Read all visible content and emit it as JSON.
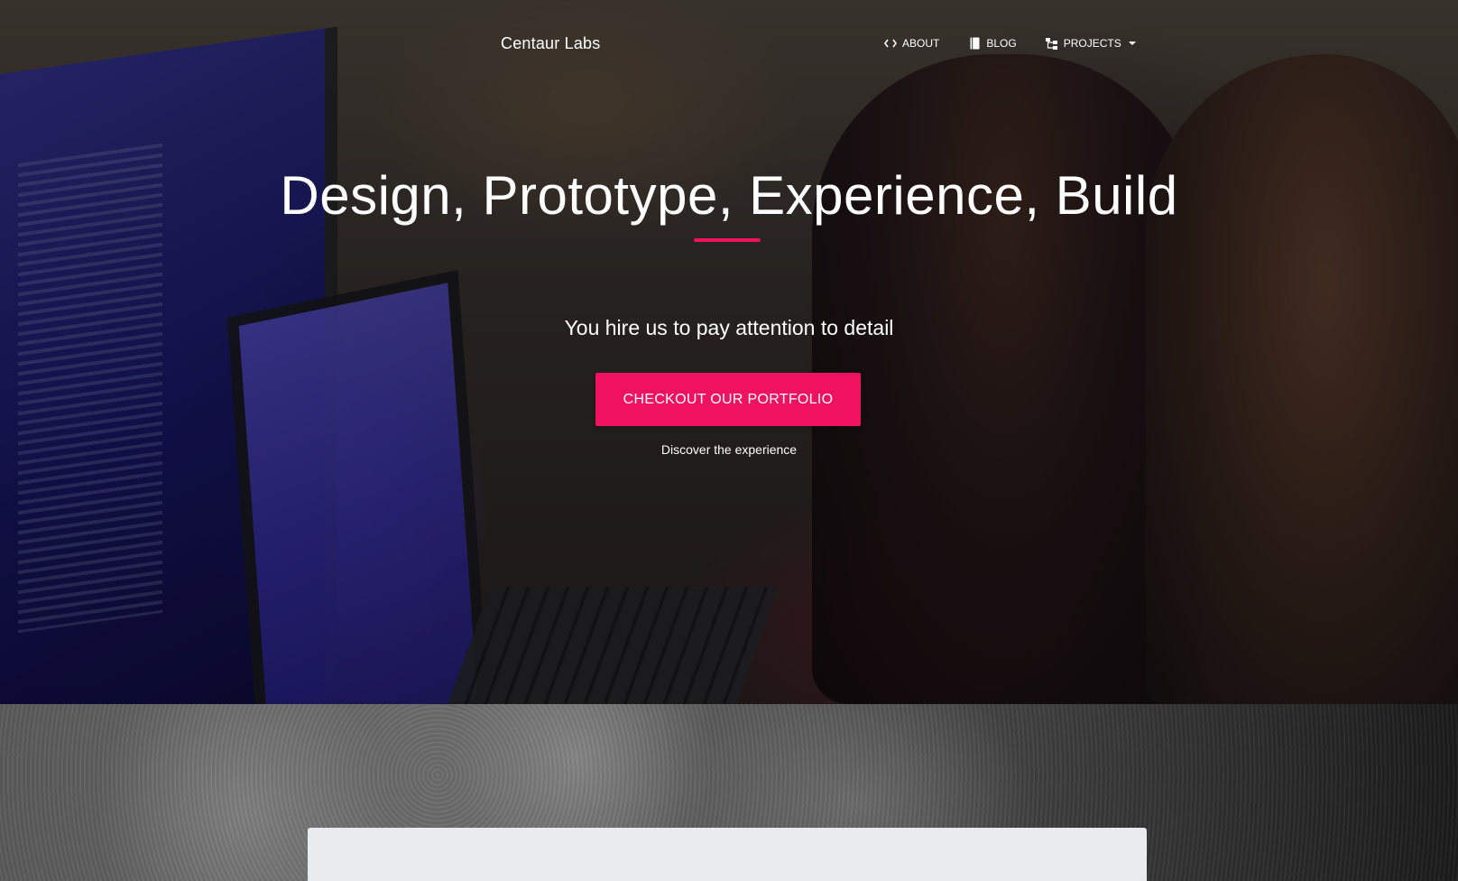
{
  "brand": {
    "name": "Centaur Labs"
  },
  "nav": {
    "items": [
      {
        "label": "ABOUT",
        "icon": "code-icon"
      },
      {
        "label": "BLOG",
        "icon": "book-icon"
      },
      {
        "label": "PROJECTS",
        "icon": "sitemap-icon",
        "has_dropdown": true
      }
    ]
  },
  "hero": {
    "title": "Design, Prototype, Experience, Build",
    "subtitle": "You hire us to pay attention to detail",
    "cta_label": "CHECKOUT OUR PORTFOLIO",
    "discover_text": "Discover the experience"
  },
  "colors": {
    "accent": "#f0125f",
    "card": "#e9ecef"
  }
}
